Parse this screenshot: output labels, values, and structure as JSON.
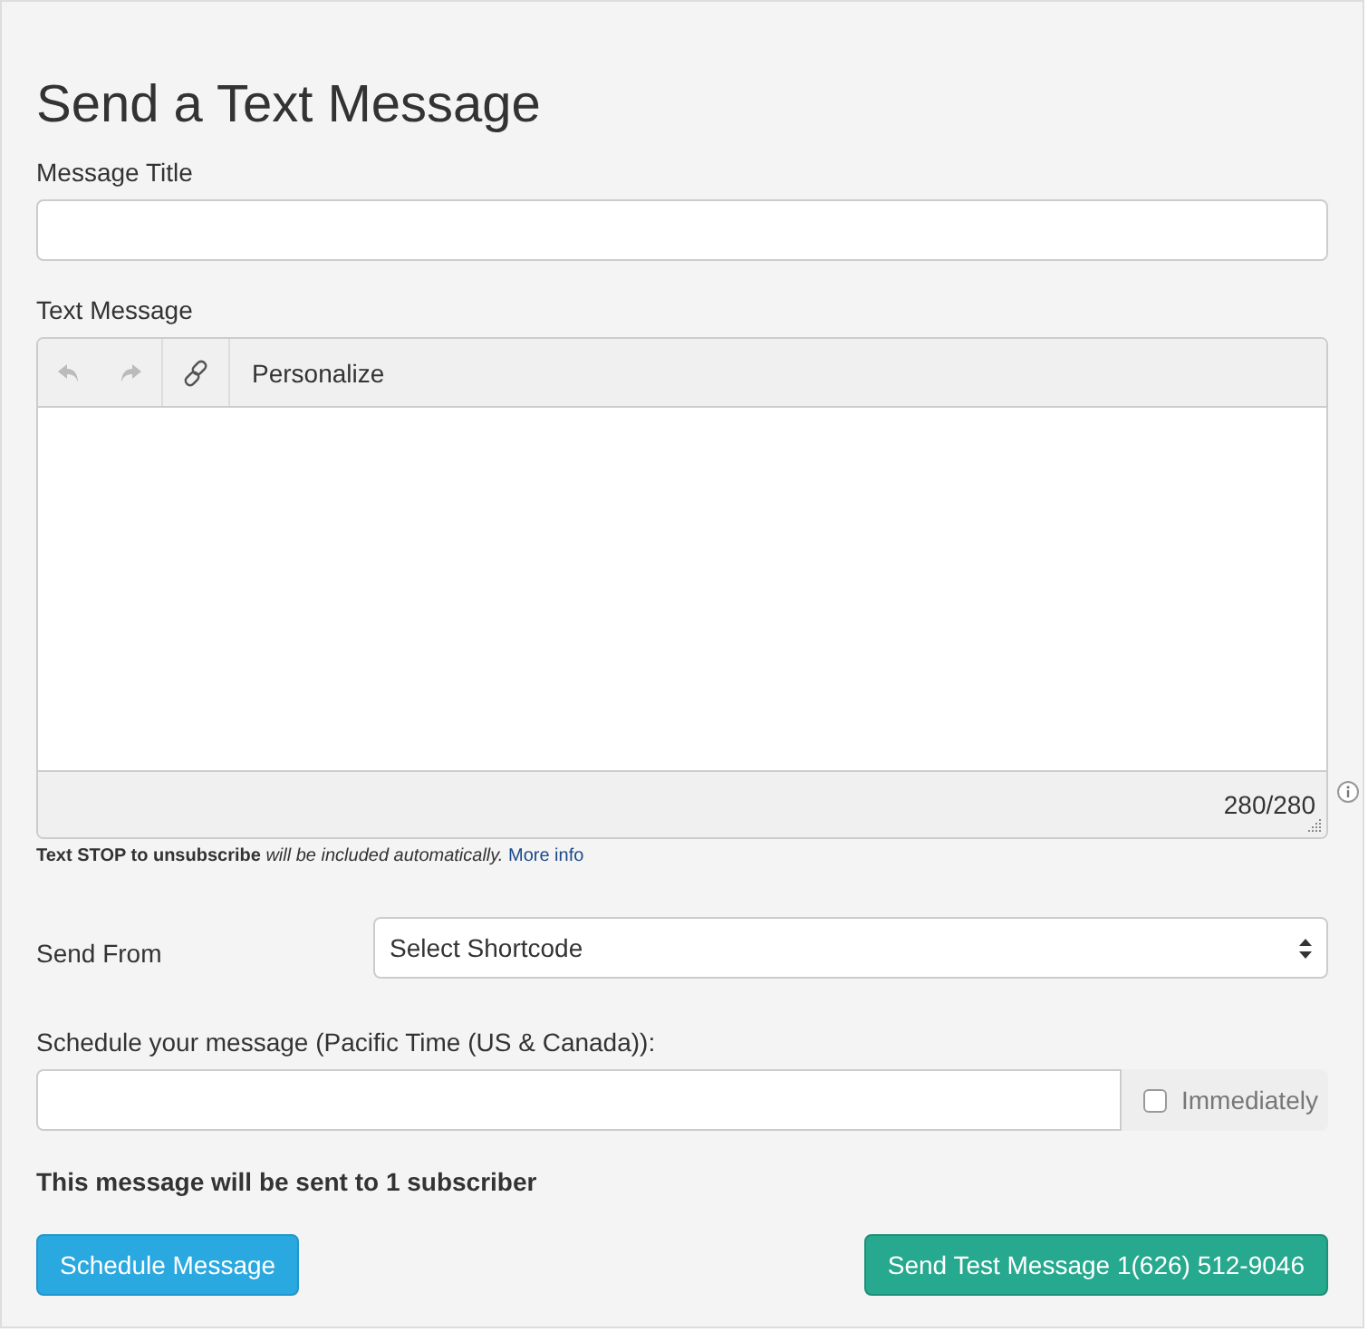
{
  "title": "Send a Text Message",
  "message_title": {
    "label": "Message Title"
  },
  "text_message": {
    "label": "Text Message",
    "toolbar": [
      {
        "kind": "undo",
        "disabled": true
      },
      {
        "kind": "redo",
        "disabled": true
      },
      {
        "kind": "link",
        "disabled": false
      },
      {
        "kind": "text",
        "label": "Personalize",
        "disabled": false
      }
    ],
    "counter": "280/280"
  },
  "note": {
    "text": "**Text STOP to unsubscribe** *will be included automatically.*",
    "link": "More info"
  },
  "send_from": {
    "label": "Send From",
    "placeholder": "Select Shortcode"
  },
  "schedule": {
    "label": "Schedule your message (Pacific Time (US & Canada)):",
    "immediately": {
      "label": "Immediately",
      "checked": false
    }
  },
  "summary": "This message will be sent to 1 subscriber",
  "buttons": [
    {
      "kind": "primary",
      "label": "Schedule Message"
    },
    {
      "kind": "success",
      "label": "Send Test Message 1(626) 512-9046"
    }
  ]
}
